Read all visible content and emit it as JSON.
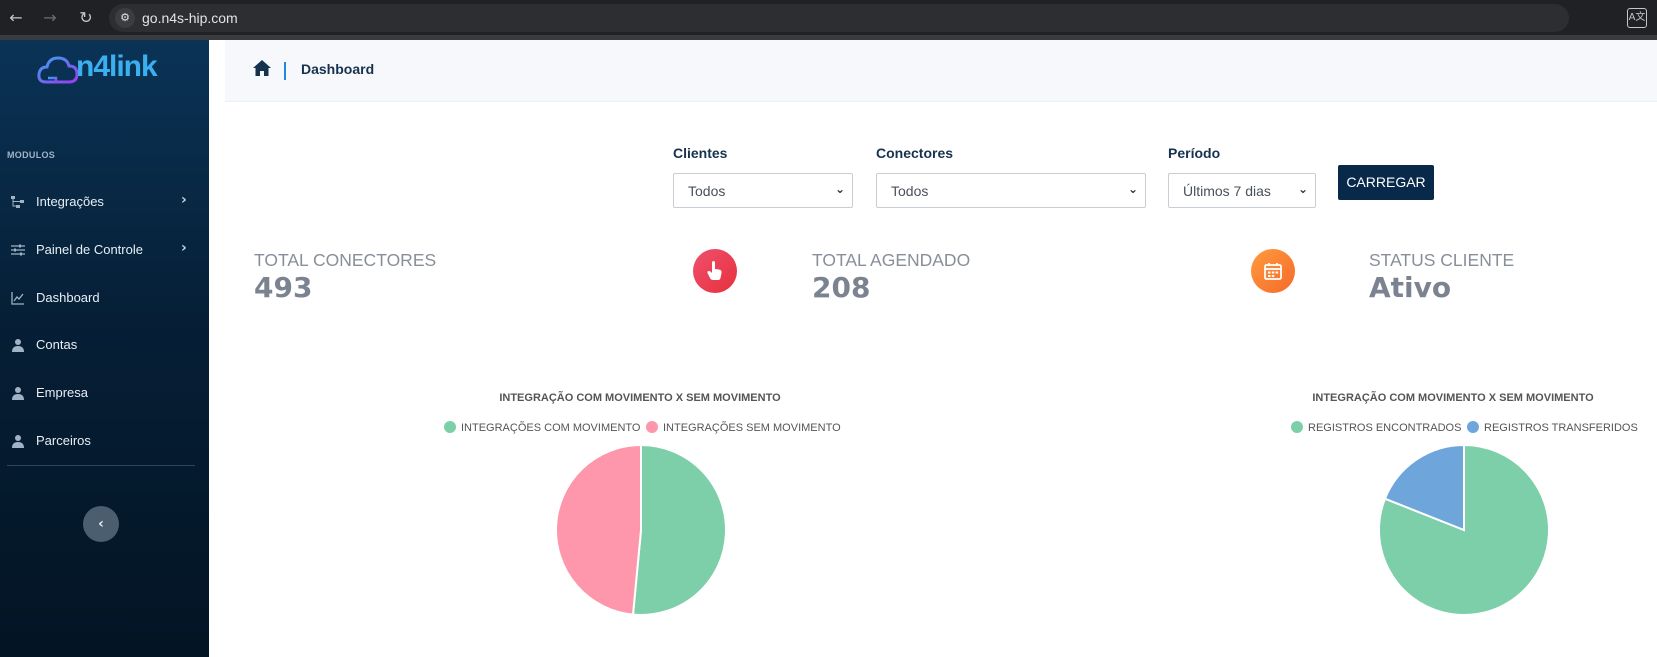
{
  "browser": {
    "url": "go.n4s-hip.com"
  },
  "sidebar": {
    "logo": "n4link",
    "section_label": "MODULOS",
    "items": [
      {
        "label": "Integrações",
        "icon": "sitemap-icon",
        "has_submenu": true
      },
      {
        "label": "Painel de Controle",
        "icon": "sliders-icon",
        "has_submenu": true
      },
      {
        "label": "Dashboard",
        "icon": "chart-line-icon",
        "has_submenu": false
      },
      {
        "label": "Contas",
        "icon": "user-icon",
        "has_submenu": false
      },
      {
        "label": "Empresa",
        "icon": "user-icon",
        "has_submenu": false
      },
      {
        "label": "Parceiros",
        "icon": "user-icon",
        "has_submenu": false
      }
    ]
  },
  "breadcrumb": {
    "current": "Dashboard"
  },
  "filters": {
    "clientes": {
      "label": "Clientes",
      "value": "Todos"
    },
    "conectores": {
      "label": "Conectores",
      "value": "Todos"
    },
    "periodo": {
      "label": "Período",
      "value": "Últimos 7 dias"
    },
    "load_button": "CARREGAR"
  },
  "stats": {
    "total_conectores": {
      "title": "TOTAL CONECTORES",
      "value": "493"
    },
    "total_agendado": {
      "title": "TOTAL AGENDADO",
      "value": "208"
    },
    "status_cliente": {
      "title": "STATUS CLIENTE",
      "value": "Ativo"
    }
  },
  "colors": {
    "accent": "#08294a",
    "green": "#7dcfaa",
    "pink": "#fe97ac",
    "blue": "#6ea6dc"
  },
  "chart_data": [
    {
      "type": "pie",
      "title": "INTEGRAÇÃO COM MOVIMENTO X SEM MOVIMENTO",
      "legend_position": "top",
      "series": [
        {
          "name": "INTEGRAÇÕES COM MOVIMENTO",
          "value": 51.5,
          "color": "#7dcfaa"
        },
        {
          "name": "INTEGRAÇÕES SEM MOVIMENTO",
          "value": 48.5,
          "color": "#fe97ac"
        }
      ]
    },
    {
      "type": "pie",
      "title": "INTEGRAÇÃO COM MOVIMENTO X SEM MOVIMENTO",
      "legend_position": "top",
      "series": [
        {
          "name": "REGISTROS ENCONTRADOS",
          "value": 81,
          "color": "#7dcfaa"
        },
        {
          "name": "REGISTROS TRANSFERIDOS",
          "value": 19,
          "color": "#6ea6dc"
        }
      ]
    }
  ]
}
